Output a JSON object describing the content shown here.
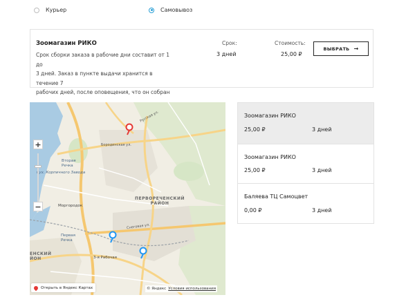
{
  "delivery_options": {
    "courier_label": "Курьер",
    "pickup_label": "Самовывоз",
    "selected": "pickup"
  },
  "store_card": {
    "title": "Зоомагазин РИКО",
    "description_lines": [
      "Срок сборки заказа в рабочие дни составит от 1 до",
      "3 дней. Заказ в пункте выдачи хранится в течение 7",
      "рабочих дней, после оповещения, что он собран"
    ],
    "term_label": "Срок:",
    "term_value": "3 дней",
    "cost_label": "Стоимость:",
    "cost_value": "25,00 ₽",
    "select_button": "ВЫБРАТЬ",
    "select_arrow": "→"
  },
  "map": {
    "labels": {
      "russkaya_street": "Русская ул.",
      "borodinskaya_street": "Бородинская ул.",
      "vtoraya_rechka": "Вторая\nРечка",
      "zaliv": "бух. Корпичного Завода",
      "morgorodok": "Моргородок",
      "district": "ПЕРВОРЕЧЕНСКИЙ\nРАЙОН",
      "snegovaya": "Снеговая ул.",
      "pervaya_rechka": "Первая\nРечка",
      "tretya_rabochaya": "3-я Рабочая",
      "district_left": "ЕНСКИЙ\nЙОН"
    },
    "zoom_in": "+",
    "zoom_out": "−",
    "open_in_maps": "Открыть в Яндекс Картах",
    "copyright": "© Яндекс",
    "terms": "Условия использования",
    "marker_colors": {
      "selected": "#e53935",
      "other": "#2196f3"
    }
  },
  "pickup_points": [
    {
      "name": "Зоомагазин РИКО",
      "price": "25,00 ₽",
      "term": "3 дней",
      "selected": true
    },
    {
      "name": "Зоомагазин РИКО",
      "price": "25,00 ₽",
      "term": "3 дней",
      "selected": false
    },
    {
      "name": "Баляева ТЦ Самоцвет",
      "price": "0,00 ₽",
      "term": "3 дней",
      "selected": false
    }
  ]
}
